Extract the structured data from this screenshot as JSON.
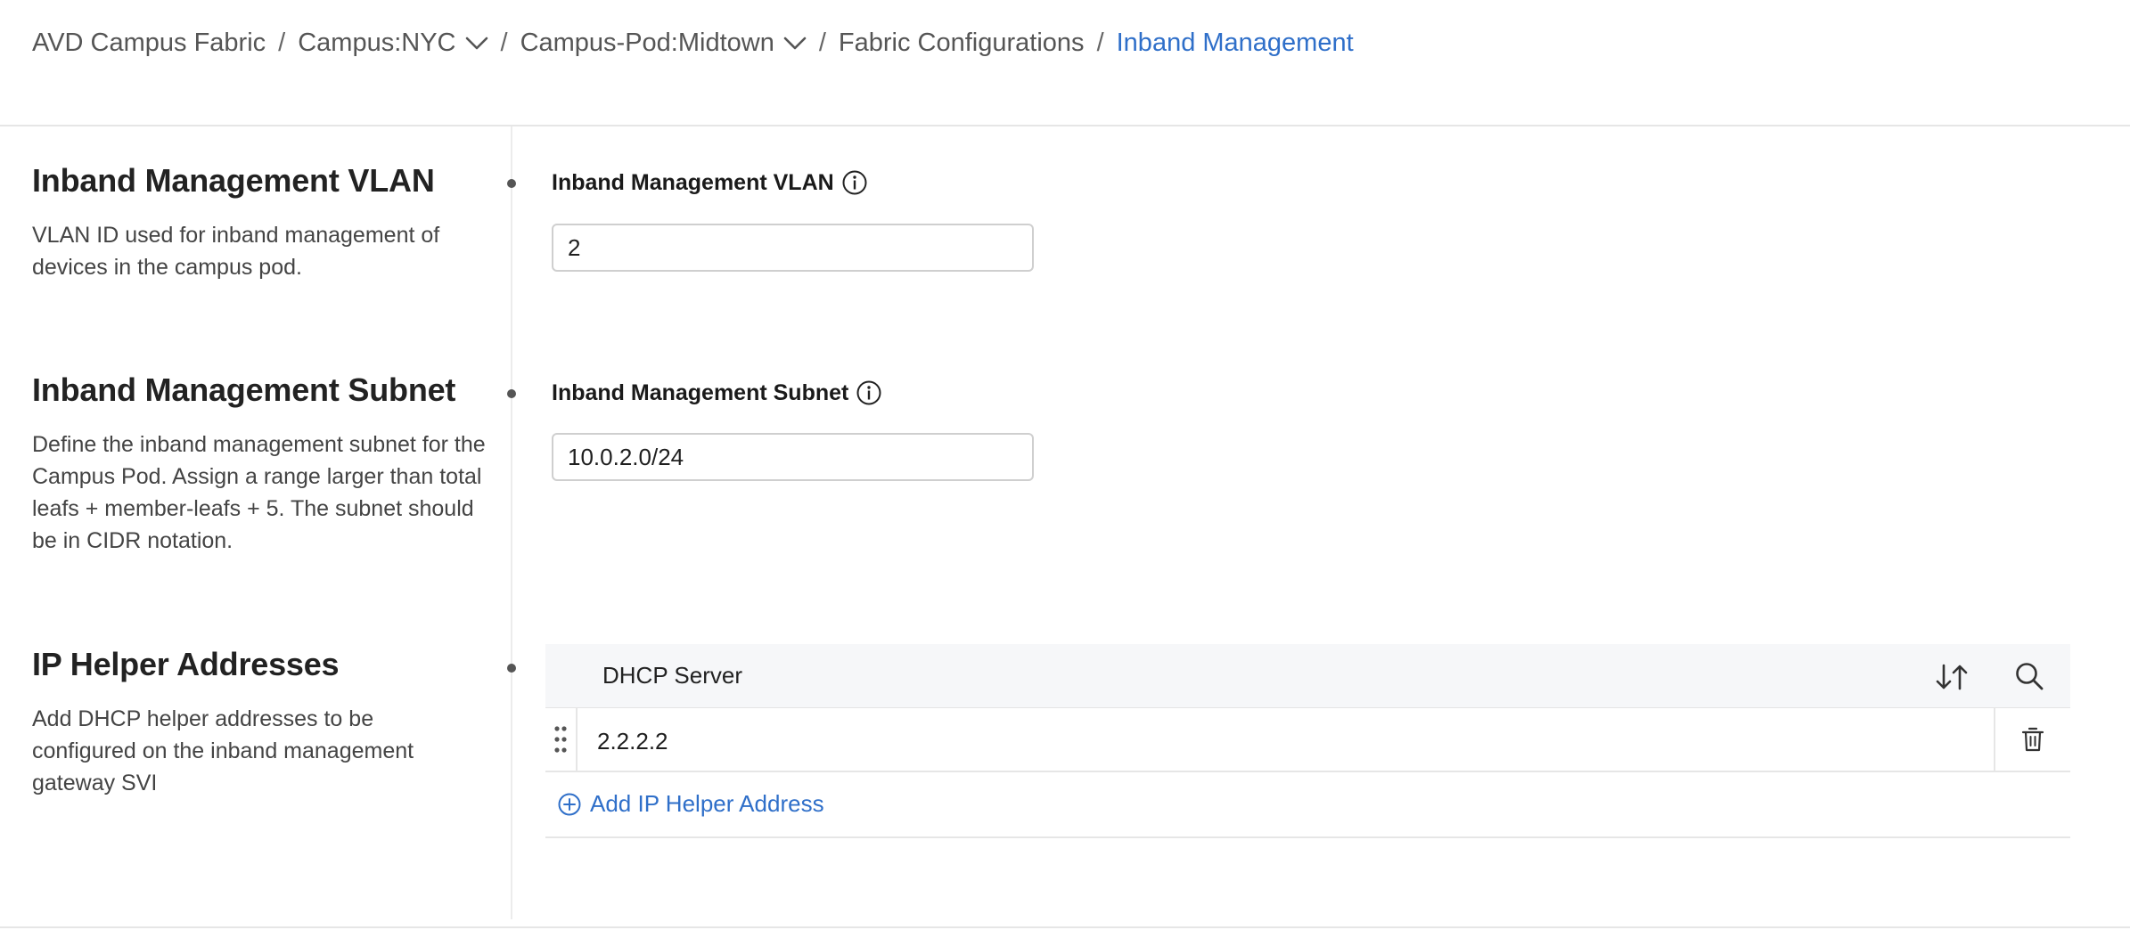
{
  "breadcrumb": {
    "items": [
      {
        "label": "AVD Campus Fabric",
        "has_dropdown": false
      },
      {
        "label": "Campus:NYC",
        "has_dropdown": true
      },
      {
        "label": "Campus-Pod:Midtown",
        "has_dropdown": true
      },
      {
        "label": "Fabric Configurations",
        "has_dropdown": false
      },
      {
        "label": "Inband Management",
        "has_dropdown": false,
        "current": true
      }
    ],
    "separator": "/"
  },
  "sections": {
    "vlan": {
      "title": "Inband Management VLAN",
      "description": "VLAN ID used for inband management of devices in the campus pod.",
      "field_label": "Inband Management VLAN",
      "value": "2"
    },
    "subnet": {
      "title": "Inband Management Subnet",
      "description": "Define the inband management subnet for the Campus Pod. Assign a range larger than total leafs + member-leafs + 5. The subnet should be in CIDR notation.",
      "field_label": "Inband Management Subnet",
      "value": "10.0.2.0/24"
    },
    "helpers": {
      "title": "IP Helper Addresses",
      "description": "Add DHCP helper addresses to be configured on the inband management gateway SVI",
      "table": {
        "column_header": "DHCP Server",
        "rows": [
          {
            "value": "2.2.2.2"
          }
        ],
        "add_label": "Add IP Helper Address"
      }
    }
  },
  "icons": {
    "chevron": "chevron-down-icon",
    "info": "info-icon",
    "sort": "sort-icon",
    "search": "search-icon",
    "drag": "drag-handle-icon",
    "trash": "trash-icon",
    "add": "plus-circle-icon"
  },
  "colors": {
    "link": "#2f6fc9",
    "text": "#1f1f1f",
    "muted": "#555555",
    "border": "#cfcfcf",
    "table_header_bg": "#f6f7f9"
  }
}
